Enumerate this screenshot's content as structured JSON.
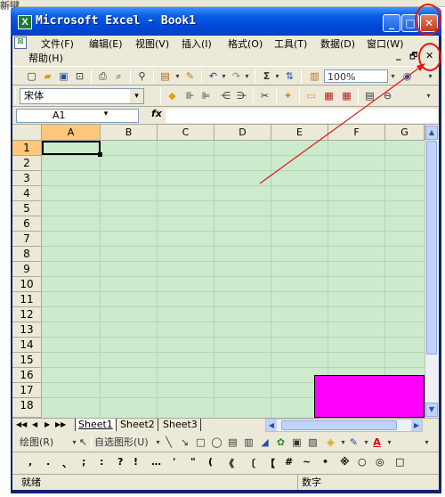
{
  "bg": {
    "text": "新键"
  },
  "window": {
    "title": "Microsoft Excel - Book1",
    "controls": {
      "minimize": "_",
      "maximize": "□",
      "close": "✕"
    },
    "doc_controls": {
      "minimize": "_",
      "restore": "🗗",
      "close": "✕"
    }
  },
  "menubar": {
    "items": [
      "文件(F)",
      "编辑(E)",
      "视图(V)",
      "插入(I)",
      "格式(O)",
      "工具(T)",
      "数据(D)",
      "窗口(W)",
      "帮助(H)"
    ]
  },
  "toolbar": {
    "zoom": "100%"
  },
  "format": {
    "font": "宋体"
  },
  "formula": {
    "name_box": "A1",
    "fx": "fx",
    "value": ""
  },
  "grid": {
    "columns": [
      "A",
      "B",
      "C",
      "D",
      "E",
      "F",
      "G"
    ],
    "rows": [
      "1",
      "2",
      "3",
      "4",
      "5",
      "6",
      "7",
      "8",
      "9",
      "10",
      "11",
      "12",
      "13",
      "14",
      "15",
      "16",
      "17",
      "18"
    ]
  },
  "sheets": {
    "tabs": [
      "Sheet1",
      "Sheet2",
      "Sheet3"
    ],
    "active": "Sheet1",
    "nav": [
      "◀◀",
      "◀",
      "▶",
      "▶▶"
    ]
  },
  "drawing": {
    "draw_label": "绘图(R)",
    "autoshapes_label": "自选图形(U)"
  },
  "symbols": [
    ",",
    ".",
    "、",
    ";",
    ":",
    "?",
    "!",
    "…",
    "'",
    "\"",
    "(",
    "《",
    "〔",
    "【",
    "#",
    "~",
    "•",
    "※",
    "○",
    "◎",
    "□"
  ],
  "status": {
    "left": "就绪",
    "right": "数字"
  },
  "colors": {
    "titlebar": "#0a5fe6",
    "sheet_bg": "#ccebcc",
    "shape": "#ff00ff",
    "annotation": "#e21616"
  }
}
